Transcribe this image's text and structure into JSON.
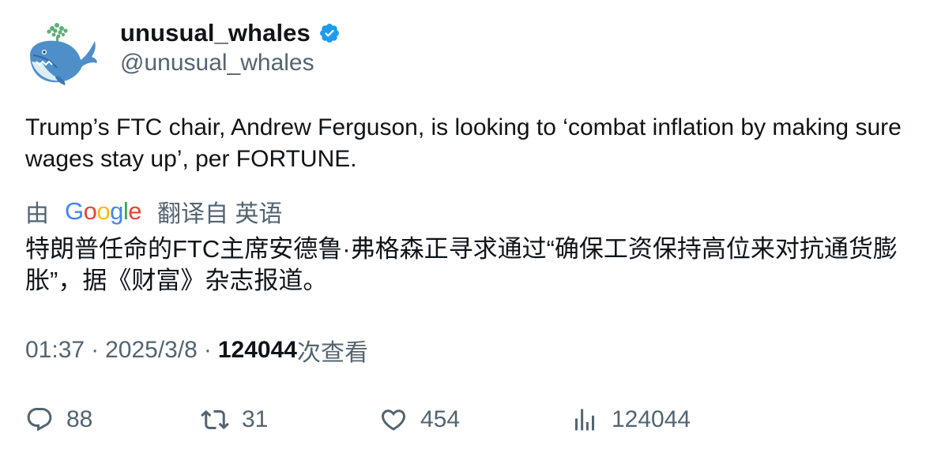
{
  "author": {
    "display_name": "unusual_whales",
    "handle": "@unusual_whales",
    "verified": true,
    "verified_color": "#1d9bf0"
  },
  "tweet": {
    "text": "Trump’s FTC chair, Andrew Ferguson, is looking to ‘combat inflation by making sure wages stay up’, per FORTUNE."
  },
  "translation": {
    "prefix": "由",
    "provider_letters": [
      "G",
      "o",
      "o",
      "g",
      "l",
      "e"
    ],
    "suffix": "翻译自 英语",
    "text": "特朗普任命的FTC主席安德鲁·弗格森正寻求通过“确保工资保持高位来对抗通货膨胀”，据《财富》杂志报道。"
  },
  "meta": {
    "time": "01:37",
    "separator": "·",
    "date": "2025/3/8",
    "views_count": "124044",
    "views_label": "次查看"
  },
  "actions": {
    "replies": "88",
    "reposts": "31",
    "likes": "454",
    "views": "124044"
  },
  "colors": {
    "text_primary": "#0f1419",
    "text_secondary": "#536471"
  },
  "icons": [
    "whale-logo-icon",
    "verified-badge-icon",
    "reply-icon",
    "repost-icon",
    "like-icon",
    "views-icon"
  ]
}
